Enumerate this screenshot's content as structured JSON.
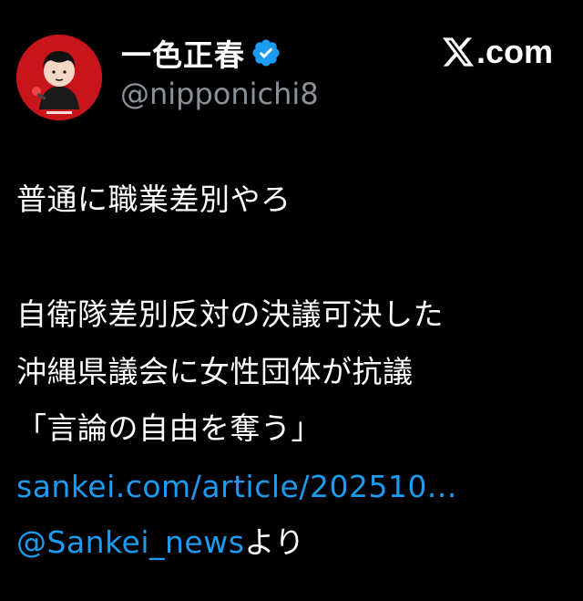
{
  "user": {
    "display_name": "一色正春",
    "handle": "@nipponichi8",
    "avatar_icon": "avatar-icon",
    "verified_icon": "verified-badge-icon"
  },
  "brand": {
    "label": ".com",
    "icon": "x-logo-icon"
  },
  "tweet": {
    "line1": "普通に職業差別やろ",
    "line2": "自衛隊差別反対の決議可決した",
    "line3": "沖縄県議会に女性団体が抗議",
    "line4": "「言論の自由を奪う」",
    "link": "sankei.com/article/202510...",
    "mention": "@Sankei_news",
    "mention_suffix": "より"
  },
  "colors": {
    "background": "#000000",
    "text": "#ffffff",
    "secondary_text": "#8b9199",
    "link": "#1d9bf0",
    "verified": "#1d9bf0",
    "avatar_bg": "#c8141b"
  }
}
